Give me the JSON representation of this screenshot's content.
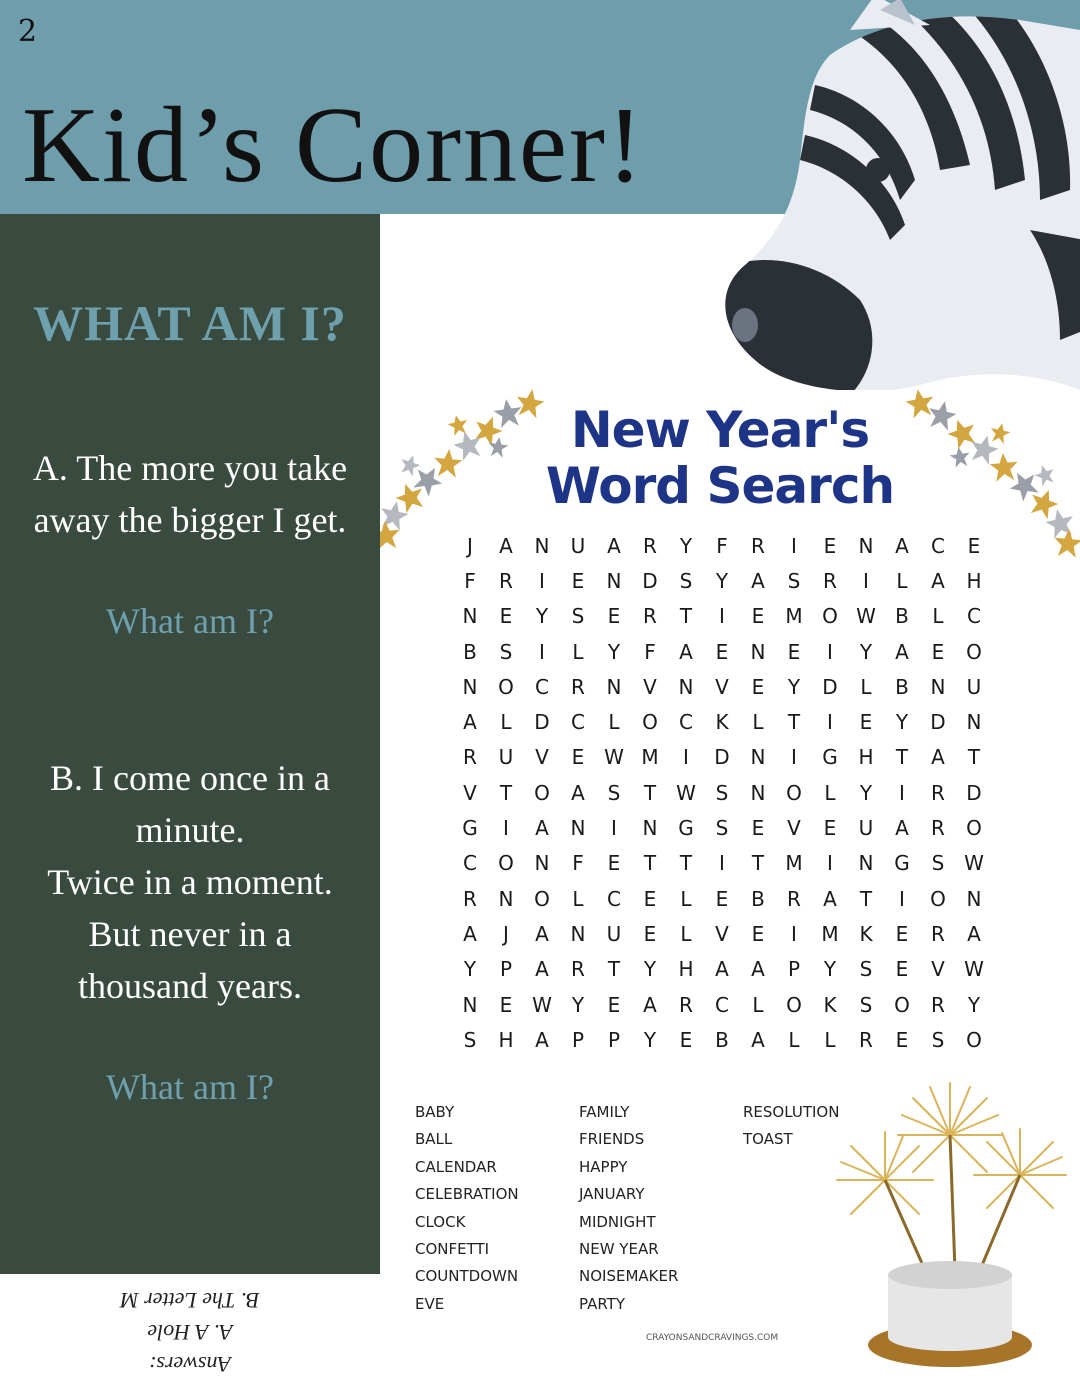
{
  "page_number": "2",
  "title": "Kid’s Corner!",
  "sidebar": {
    "heading": "WHAT AM I?",
    "riddle_a": [
      "A. The more you take",
      "away the bigger I get."
    ],
    "riddle_b": [
      "B. I come once in a",
      "minute.",
      "Twice in a moment.",
      "But never in a",
      "thousand years."
    ],
    "question": "What am I?"
  },
  "answers": {
    "label": "Answers:",
    "a": "A. A Hole",
    "b": "B. The Letter M"
  },
  "word_search": {
    "title_line1": "New Year's",
    "title_line2": "Word Search",
    "grid": [
      "JANUARYFRIENACE",
      "FRIENDSYASRILAH",
      "NEYSERTIEMOWBLC",
      "BSILYFAENEIYAEO",
      "NOCRNVNVEYDLBNU",
      "ALDCLOCKLTIEYDN",
      "RUVEWMIDNIGHTAT",
      "VTOASTWSNOLYIRD",
      "GIANINGSEVEUARO",
      "CONFETTITMINGSW",
      "RNOLCELEBRATION",
      "AJANUELVEIMKERA",
      "YPARTYHAAPYSEVW",
      "NEWYEARCLOKSORY",
      "SHAPPYEBALLRESO"
    ],
    "words_col1": [
      "BABY",
      "BALL",
      "CALENDAR",
      "CELEBRATION",
      "CLOCK",
      "CONFETTI",
      "COUNTDOWN",
      "EVE"
    ],
    "words_col2": [
      "FAMILY",
      "FRIENDS",
      "HAPPY",
      "JANUARY",
      "MIDNIGHT",
      "NEW YEAR",
      "NOISEMAKER",
      "PARTY"
    ],
    "words_col3": [
      "RESOLUTION",
      "TOAST"
    ],
    "credit": "CRAYONSANDCRAVINGS.COM"
  },
  "colors": {
    "header_bg": "#6e9eac",
    "sidebar_bg": "#394a3f",
    "accent_text": "#6fa0ae",
    "title_blue": "#1d3487"
  },
  "icons": [
    "zebra-illustration",
    "gold-silver-stars",
    "sparkler-cake"
  ]
}
